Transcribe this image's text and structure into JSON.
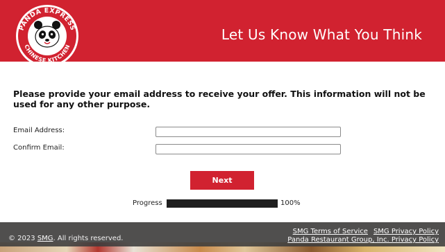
{
  "brand": {
    "logo_text_top": "PANDA EXPRESS",
    "logo_text_bottom": "CHINESE KITCHEN",
    "logo_mark": "®",
    "primary_color": "#d12230"
  },
  "header": {
    "title": "Let Us Know What You Think"
  },
  "form": {
    "intro": "Please provide your email address to receive your offer. This information will not be used for any other purpose.",
    "email_label": "Email Address:",
    "email_value": "",
    "confirm_label": "Confirm Email:",
    "confirm_value": "",
    "next_label": "Next"
  },
  "progress": {
    "label": "Progress",
    "value": 1.0,
    "percent_text": "100%"
  },
  "footer": {
    "copyright_prefix": "© 2023 ",
    "copyright_link": "SMG",
    "copyright_suffix": ". All rights reserved.",
    "link_terms": "SMG Terms of Service",
    "link_privacy": "SMG Privacy Policy",
    "link_panda_privacy": "Panda Restaurant Group, Inc. Privacy Policy"
  }
}
